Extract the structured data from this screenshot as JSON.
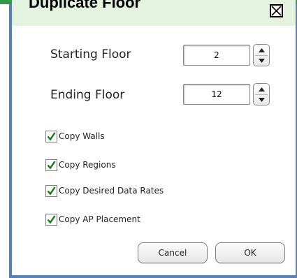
{
  "dialog": {
    "title": "Duplicate Floor",
    "close_icon": "close-x-icon"
  },
  "fields": {
    "starting_floor": {
      "label": "Starting Floor",
      "value": "2"
    },
    "ending_floor": {
      "label": "Ending Floor",
      "value": "12"
    }
  },
  "options": [
    {
      "label": "Copy Walls",
      "checked": true
    },
    {
      "label": "Copy Regions",
      "checked": true
    },
    {
      "label": "Copy Desired Data Rates",
      "checked": true
    },
    {
      "label": "Copy AP Placement",
      "checked": true
    }
  ],
  "buttons": {
    "cancel": "Cancel",
    "ok": "OK"
  },
  "colors": {
    "accent_green": "#2f9a4a",
    "titlebar_bg": "#e4f3df",
    "window_border": "#5a7fb5",
    "check_mark": "#1a7a1a"
  }
}
